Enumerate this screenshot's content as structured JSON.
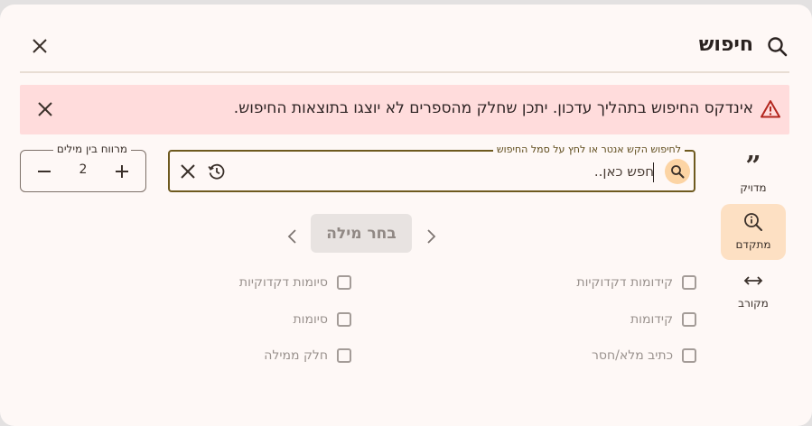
{
  "dialog": {
    "title": "חיפוש",
    "icons": {
      "title": "search-icon",
      "close": "close-icon"
    }
  },
  "alert": {
    "text": "אינדקס החיפוש בתהליך עדכון. יתכן שחלק מהספרים לא יוצגו בתוצאות החיפוש.",
    "icon": "warning-icon",
    "background": "#ffdcdc"
  },
  "modes": [
    {
      "label": "מדויק",
      "icon": "quote-icon",
      "active": false
    },
    {
      "label": "מתקדם",
      "icon": "search-info-icon",
      "active": true
    },
    {
      "label": "מקורב",
      "icon": "arrows-horizontal-icon",
      "active": false
    }
  ],
  "search": {
    "label": "לחיפוש הקש אנטר או לחץ על סמל החיפוש",
    "placeholder": "חפש כאן..",
    "value": "",
    "border_color": "#6e5a1f"
  },
  "word_gap": {
    "label": "מרווח בין מילים",
    "value": "2"
  },
  "word_picker": {
    "label": "בחר מילה"
  },
  "options": {
    "right_column": [
      "קידומות דקדוקיות",
      "קידומות",
      "כתיב מלא/חסר"
    ],
    "left_column": [
      "סיומות דקדוקיות",
      "סיומות",
      "חלק ממילה"
    ]
  },
  "colors": {
    "accent": "#fcd4a4",
    "active_mode": "#fde0c3",
    "surface": "#fef8f6"
  }
}
